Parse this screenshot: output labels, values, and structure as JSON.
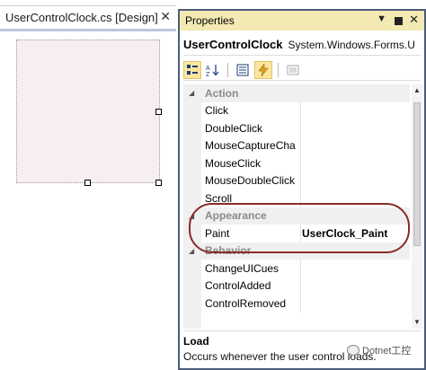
{
  "designer": {
    "tab_title": "UserControlClock.cs [Design]",
    "tab_close": "✕"
  },
  "properties": {
    "title": "Properties",
    "dropdown_glyph": "▼",
    "close_glyph": "✕",
    "object_name": "UserControlClock",
    "object_type": "System.Windows.Forms.U",
    "toolbar": {
      "categorized_icon": "categorized-icon",
      "alphabetical_icon": "alphabetical-icon",
      "properties_icon": "properties-icon",
      "events_icon": "lightning-icon",
      "pages_icon": "property-pages-icon"
    },
    "rows": [
      {
        "type": "category",
        "arrow": "◢",
        "name": "Action"
      },
      {
        "type": "item",
        "name": "Click",
        "value": ""
      },
      {
        "type": "item",
        "name": "DoubleClick",
        "value": ""
      },
      {
        "type": "item",
        "name": "MouseCaptureCha",
        "value": ""
      },
      {
        "type": "item",
        "name": "MouseClick",
        "value": ""
      },
      {
        "type": "item",
        "name": "MouseDoubleClick",
        "value": ""
      },
      {
        "type": "item",
        "name": "Scroll",
        "value": ""
      },
      {
        "type": "category",
        "arrow": "◢",
        "name": "Appearance"
      },
      {
        "type": "item",
        "name": "Paint",
        "value": "UserClock_Paint"
      },
      {
        "type": "category",
        "arrow": "◢",
        "name": "Behavior"
      },
      {
        "type": "item",
        "name": "ChangeUICues",
        "value": ""
      },
      {
        "type": "item",
        "name": "ControlAdded",
        "value": ""
      },
      {
        "type": "item",
        "name": "ControlRemoved",
        "value": ""
      }
    ],
    "description": {
      "title": "Load",
      "text": "Occurs whenever the user control loads."
    }
  },
  "watermark": {
    "text": "Dotnet工控"
  },
  "colors": {
    "titlebar_active": "#f3e9b2",
    "window_frame": "#4b5c7a",
    "highlight_ellipse": "#8a2b2b",
    "control_fill": "#f7eef0"
  }
}
